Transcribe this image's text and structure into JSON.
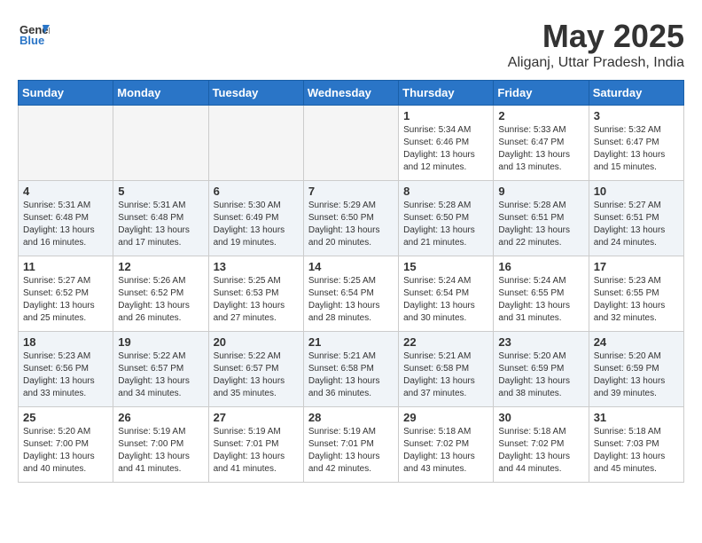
{
  "header": {
    "logo_line1": "General",
    "logo_line2": "Blue",
    "month_year": "May 2025",
    "location": "Aliganj, Uttar Pradesh, India"
  },
  "days_of_week": [
    "Sunday",
    "Monday",
    "Tuesday",
    "Wednesday",
    "Thursday",
    "Friday",
    "Saturday"
  ],
  "weeks": [
    [
      {
        "day": "",
        "info": ""
      },
      {
        "day": "",
        "info": ""
      },
      {
        "day": "",
        "info": ""
      },
      {
        "day": "",
        "info": ""
      },
      {
        "day": "1",
        "info": "Sunrise: 5:34 AM\nSunset: 6:46 PM\nDaylight: 13 hours\nand 12 minutes."
      },
      {
        "day": "2",
        "info": "Sunrise: 5:33 AM\nSunset: 6:47 PM\nDaylight: 13 hours\nand 13 minutes."
      },
      {
        "day": "3",
        "info": "Sunrise: 5:32 AM\nSunset: 6:47 PM\nDaylight: 13 hours\nand 15 minutes."
      }
    ],
    [
      {
        "day": "4",
        "info": "Sunrise: 5:31 AM\nSunset: 6:48 PM\nDaylight: 13 hours\nand 16 minutes."
      },
      {
        "day": "5",
        "info": "Sunrise: 5:31 AM\nSunset: 6:48 PM\nDaylight: 13 hours\nand 17 minutes."
      },
      {
        "day": "6",
        "info": "Sunrise: 5:30 AM\nSunset: 6:49 PM\nDaylight: 13 hours\nand 19 minutes."
      },
      {
        "day": "7",
        "info": "Sunrise: 5:29 AM\nSunset: 6:50 PM\nDaylight: 13 hours\nand 20 minutes."
      },
      {
        "day": "8",
        "info": "Sunrise: 5:28 AM\nSunset: 6:50 PM\nDaylight: 13 hours\nand 21 minutes."
      },
      {
        "day": "9",
        "info": "Sunrise: 5:28 AM\nSunset: 6:51 PM\nDaylight: 13 hours\nand 22 minutes."
      },
      {
        "day": "10",
        "info": "Sunrise: 5:27 AM\nSunset: 6:51 PM\nDaylight: 13 hours\nand 24 minutes."
      }
    ],
    [
      {
        "day": "11",
        "info": "Sunrise: 5:27 AM\nSunset: 6:52 PM\nDaylight: 13 hours\nand 25 minutes."
      },
      {
        "day": "12",
        "info": "Sunrise: 5:26 AM\nSunset: 6:52 PM\nDaylight: 13 hours\nand 26 minutes."
      },
      {
        "day": "13",
        "info": "Sunrise: 5:25 AM\nSunset: 6:53 PM\nDaylight: 13 hours\nand 27 minutes."
      },
      {
        "day": "14",
        "info": "Sunrise: 5:25 AM\nSunset: 6:54 PM\nDaylight: 13 hours\nand 28 minutes."
      },
      {
        "day": "15",
        "info": "Sunrise: 5:24 AM\nSunset: 6:54 PM\nDaylight: 13 hours\nand 30 minutes."
      },
      {
        "day": "16",
        "info": "Sunrise: 5:24 AM\nSunset: 6:55 PM\nDaylight: 13 hours\nand 31 minutes."
      },
      {
        "day": "17",
        "info": "Sunrise: 5:23 AM\nSunset: 6:55 PM\nDaylight: 13 hours\nand 32 minutes."
      }
    ],
    [
      {
        "day": "18",
        "info": "Sunrise: 5:23 AM\nSunset: 6:56 PM\nDaylight: 13 hours\nand 33 minutes."
      },
      {
        "day": "19",
        "info": "Sunrise: 5:22 AM\nSunset: 6:57 PM\nDaylight: 13 hours\nand 34 minutes."
      },
      {
        "day": "20",
        "info": "Sunrise: 5:22 AM\nSunset: 6:57 PM\nDaylight: 13 hours\nand 35 minutes."
      },
      {
        "day": "21",
        "info": "Sunrise: 5:21 AM\nSunset: 6:58 PM\nDaylight: 13 hours\nand 36 minutes."
      },
      {
        "day": "22",
        "info": "Sunrise: 5:21 AM\nSunset: 6:58 PM\nDaylight: 13 hours\nand 37 minutes."
      },
      {
        "day": "23",
        "info": "Sunrise: 5:20 AM\nSunset: 6:59 PM\nDaylight: 13 hours\nand 38 minutes."
      },
      {
        "day": "24",
        "info": "Sunrise: 5:20 AM\nSunset: 6:59 PM\nDaylight: 13 hours\nand 39 minutes."
      }
    ],
    [
      {
        "day": "25",
        "info": "Sunrise: 5:20 AM\nSunset: 7:00 PM\nDaylight: 13 hours\nand 40 minutes."
      },
      {
        "day": "26",
        "info": "Sunrise: 5:19 AM\nSunset: 7:00 PM\nDaylight: 13 hours\nand 41 minutes."
      },
      {
        "day": "27",
        "info": "Sunrise: 5:19 AM\nSunset: 7:01 PM\nDaylight: 13 hours\nand 41 minutes."
      },
      {
        "day": "28",
        "info": "Sunrise: 5:19 AM\nSunset: 7:01 PM\nDaylight: 13 hours\nand 42 minutes."
      },
      {
        "day": "29",
        "info": "Sunrise: 5:18 AM\nSunset: 7:02 PM\nDaylight: 13 hours\nand 43 minutes."
      },
      {
        "day": "30",
        "info": "Sunrise: 5:18 AM\nSunset: 7:02 PM\nDaylight: 13 hours\nand 44 minutes."
      },
      {
        "day": "31",
        "info": "Sunrise: 5:18 AM\nSunset: 7:03 PM\nDaylight: 13 hours\nand 45 minutes."
      }
    ]
  ]
}
